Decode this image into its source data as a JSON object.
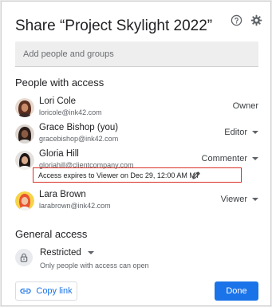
{
  "dialog": {
    "title": "Share “Project Skylight 2022”",
    "help_icon": "help-circle-icon",
    "settings_icon": "gear-icon"
  },
  "add_people": {
    "placeholder": "Add people and groups"
  },
  "people_section": {
    "heading": "People with access",
    "people": [
      {
        "name": "Lori Cole",
        "email": "loricole@ink42.com",
        "role": "Owner",
        "dropdown": false
      },
      {
        "name": "Grace Bishop (you)",
        "email": "gracebishop@ink42.com",
        "role": "Editor",
        "dropdown": true
      },
      {
        "name": "Gloria Hill",
        "email": "gloriahill@clientcompany.com",
        "role": "Commenter",
        "dropdown": true
      },
      {
        "name": "Lara Brown",
        "email": "larabrown@ink42.com",
        "role": "Viewer",
        "dropdown": true
      }
    ],
    "expiry_note": "Access expires to Viewer on Dec 29, 12:00 AM MT"
  },
  "general_access": {
    "heading": "General access",
    "setting": "Restricted",
    "description": "Only people with access can open"
  },
  "footer": {
    "copy_link_label": "Copy link",
    "done_label": "Done"
  },
  "colors": {
    "accent": "#1a73e8",
    "highlight_border": "#d93025"
  }
}
